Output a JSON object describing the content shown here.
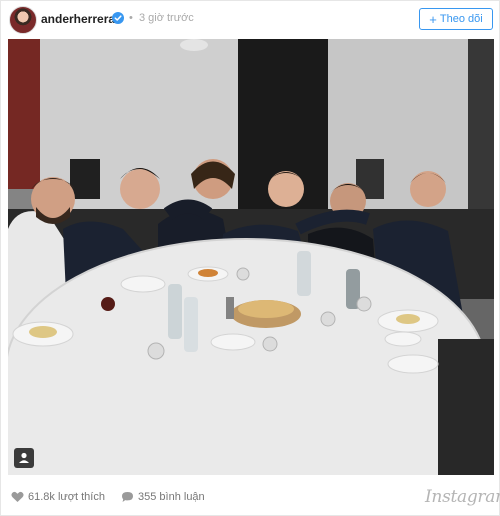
{
  "post": {
    "username": "anderherrera",
    "time_ago": "3 giờ trước",
    "separator": "•",
    "follow_label": "Theo dõi",
    "follow_plus": "+",
    "likes": "61.8k lượt thích",
    "comments": "355 bình luận",
    "brand": "Instagram"
  },
  "colors": {
    "accent": "#3897f0",
    "verified": "#3897f0",
    "meta_text": "#999999",
    "username": "#222222"
  },
  "icons": {
    "verified": "verified-badge-icon",
    "heart": "heart-icon",
    "comment": "comment-bubble-icon",
    "tag": "tagged-person-icon"
  }
}
